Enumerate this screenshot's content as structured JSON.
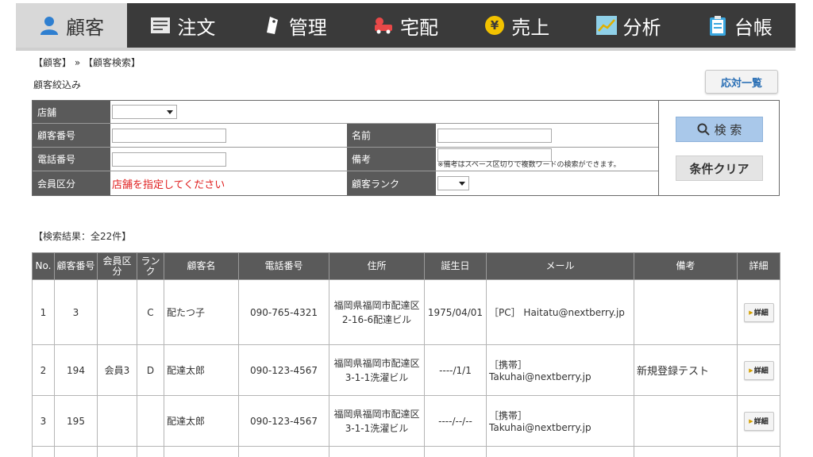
{
  "nav": {
    "items": [
      {
        "label": "顧客",
        "icon": "person-icon"
      },
      {
        "label": "注文",
        "icon": "order-list-icon"
      },
      {
        "label": "管理",
        "icon": "tag-icon"
      },
      {
        "label": "宅配",
        "icon": "delivery-truck-icon"
      },
      {
        "label": "売上",
        "icon": "yen-coin-icon"
      },
      {
        "label": "分析",
        "icon": "chart-icon"
      },
      {
        "label": "台帳",
        "icon": "clipboard-icon"
      }
    ]
  },
  "breadcrumb": "【顧客】 » 【顧客検索】",
  "filter_heading": "顧客絞込み",
  "response_list_button": "応対一覧",
  "form": {
    "store_label": "店舗",
    "customer_no_label": "顧客番号",
    "name_label": "名前",
    "phone_label": "電話番号",
    "remarks_label": "備考",
    "remarks_note": "※備考はスペース区切りで複数ワードの検索ができます。",
    "member_class_label": "会員区分",
    "member_class_warning": "店舗を指定してください",
    "customer_rank_label": "顧客ランク",
    "search_button": "検 索",
    "clear_button": "条件クリア"
  },
  "results": {
    "heading": "【検索結果：全22件】",
    "columns": [
      "No.",
      "顧客番号",
      "会員区分",
      "ランク",
      "顧客名",
      "電話番号",
      "住所",
      "誕生日",
      "メール",
      "備考",
      "詳細"
    ],
    "rows": [
      {
        "no": "1",
        "customer_no": "3",
        "member_class": "",
        "rank": "C",
        "name": "配たつ子",
        "phone": "090-765-4321",
        "address": "福岡県福岡市配達区2-16-6配達ビル",
        "birthday": "1975/04/01",
        "email": "［PC］ Haitatu@nextberry.jp",
        "remarks": "",
        "detail": "詳細"
      },
      {
        "no": "2",
        "customer_no": "194",
        "member_class": "会員3",
        "rank": "D",
        "name": "配達太郎",
        "phone": "090-123-4567",
        "address": "福岡県福岡市配達区3-1-1洗濯ビル",
        "birthday": "----/1/1",
        "email": "［携帯］ Takuhai@nextberry.jp",
        "remarks": "新規登録テスト",
        "detail": "詳細"
      },
      {
        "no": "3",
        "customer_no": "195",
        "member_class": "",
        "rank": "",
        "name": "配達太郎",
        "phone": "090-123-4567",
        "address": "福岡県福岡市配達区3-1-1洗濯ビル",
        "birthday": "----/--/--",
        "email": "［携帯］ Takuhai@nextberry.jp",
        "remarks": "",
        "detail": "詳細"
      }
    ]
  }
}
